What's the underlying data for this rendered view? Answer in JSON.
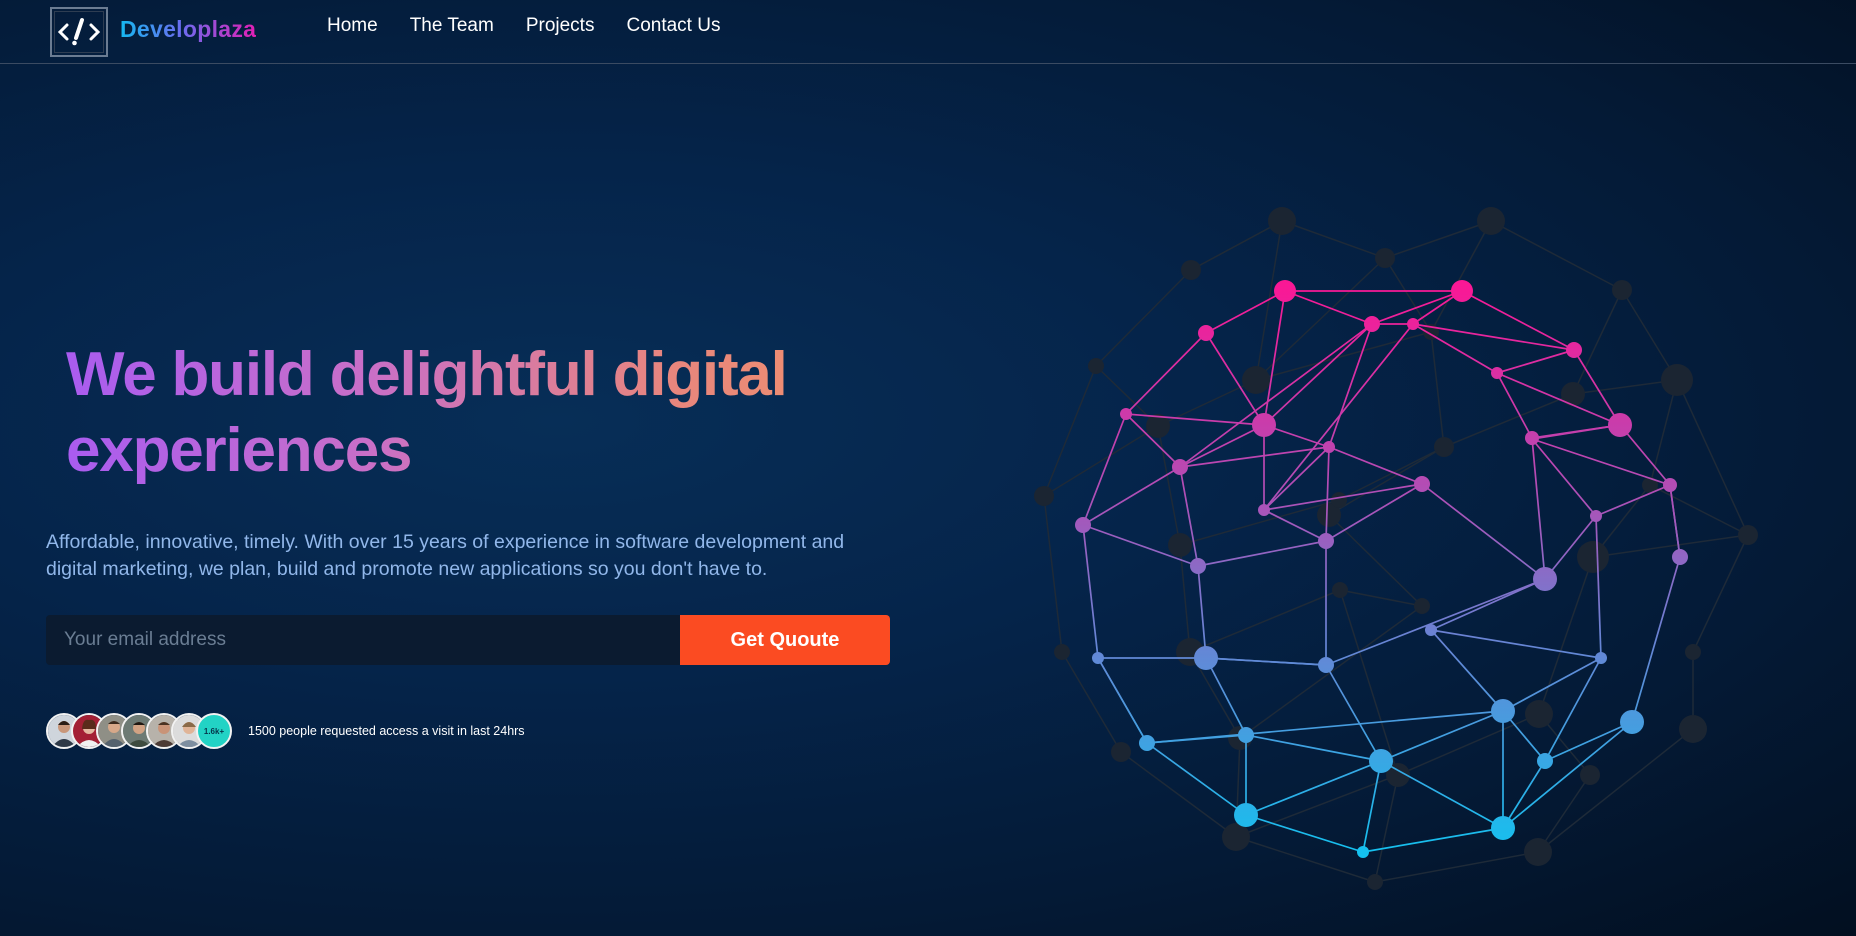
{
  "brand": {
    "name": "Developlaza",
    "logo_icon": "code-slash-icon"
  },
  "nav": {
    "links": [
      {
        "label": "Home"
      },
      {
        "label": "The Team"
      },
      {
        "label": "Projects"
      },
      {
        "label": "Contact Us"
      }
    ]
  },
  "hero": {
    "title_line1": "We build delightful digital",
    "title_line2": "experiences",
    "description_line1": "Affordable, innovative, timely. With over 15 years of experience in software development and",
    "description_line2": "digital marketing, we plan, build and promote new applications so you don't have to.",
    "email_placeholder": "Your email address",
    "email_value": "",
    "cta_label": "Get Quoute"
  },
  "social_proof": {
    "badge_label": "1.6k+",
    "text": "1500 people requested access a visit in last 24hrs",
    "avatar_count": 6
  },
  "colors": {
    "background": "#05244a",
    "accent_button": "#fb4b22",
    "title_gradient_start": "#a95cf0",
    "title_gradient_end": "#ef8f70",
    "description": "#91b7ea",
    "badge": "#22d3c5",
    "network_top": "#ff1493",
    "network_bottom": "#12c3f0"
  }
}
